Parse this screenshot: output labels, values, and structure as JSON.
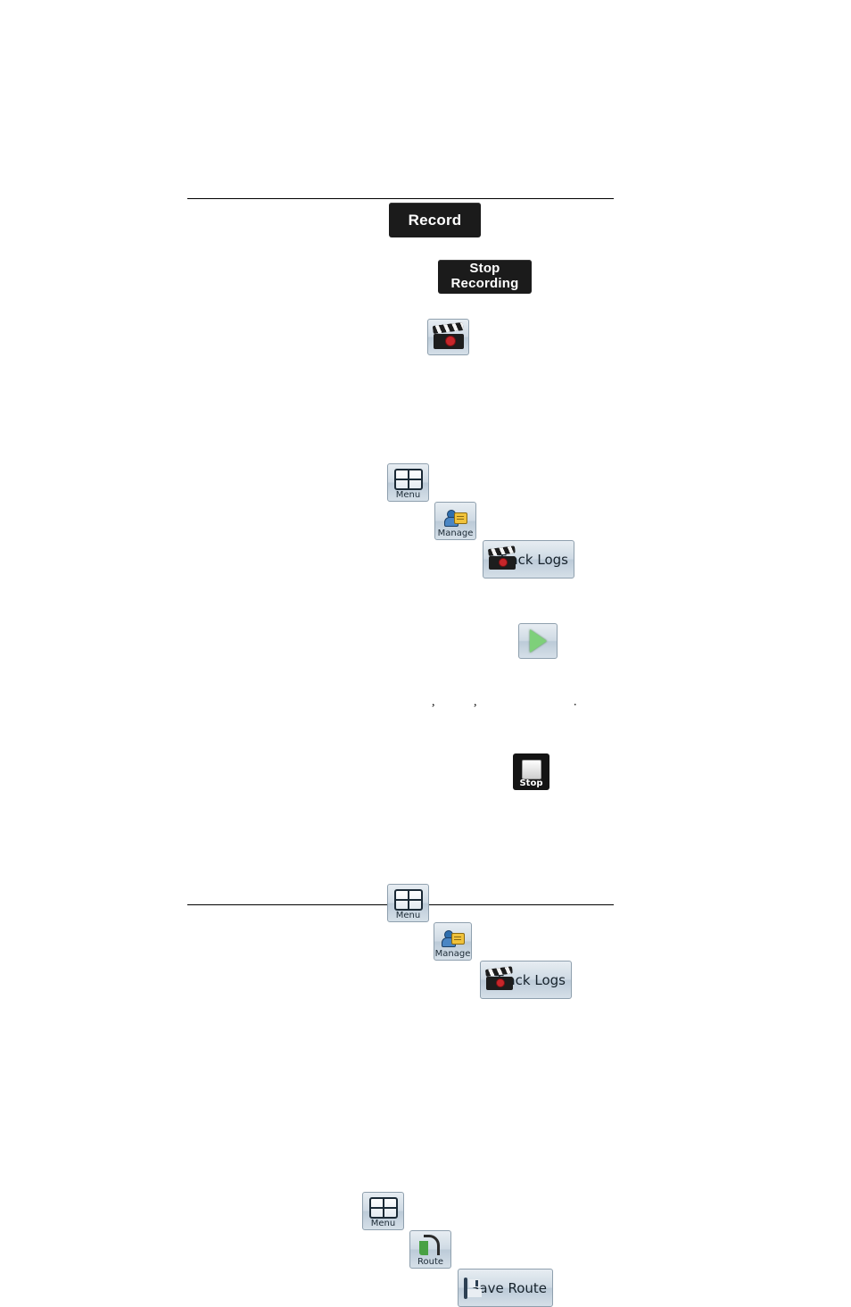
{
  "page": {
    "rules": [
      "top",
      "bottom"
    ]
  },
  "buttons": {
    "record": {
      "label": "Record"
    },
    "stop_recording": {
      "line1": "Stop",
      "line2": "Recording"
    },
    "track_log_icon": {
      "name": "track-log-clapperboard-icon"
    },
    "menu": {
      "label": "Menu"
    },
    "manage": {
      "label": "Manage"
    },
    "track_logs": {
      "label": "Track Logs"
    },
    "play": {
      "name": "play-icon"
    },
    "stop": {
      "label": "Stop"
    },
    "menu2": {
      "label": "Menu"
    },
    "manage2": {
      "label": "Manage"
    },
    "track_logs2": {
      "label": "Track Logs"
    },
    "menu3": {
      "label": "Menu"
    },
    "route": {
      "label": "Route"
    },
    "save_route": {
      "label": "Save Route"
    }
  },
  "punctuation": {
    "comma1": ",",
    "comma2": ",",
    "period1": "."
  }
}
